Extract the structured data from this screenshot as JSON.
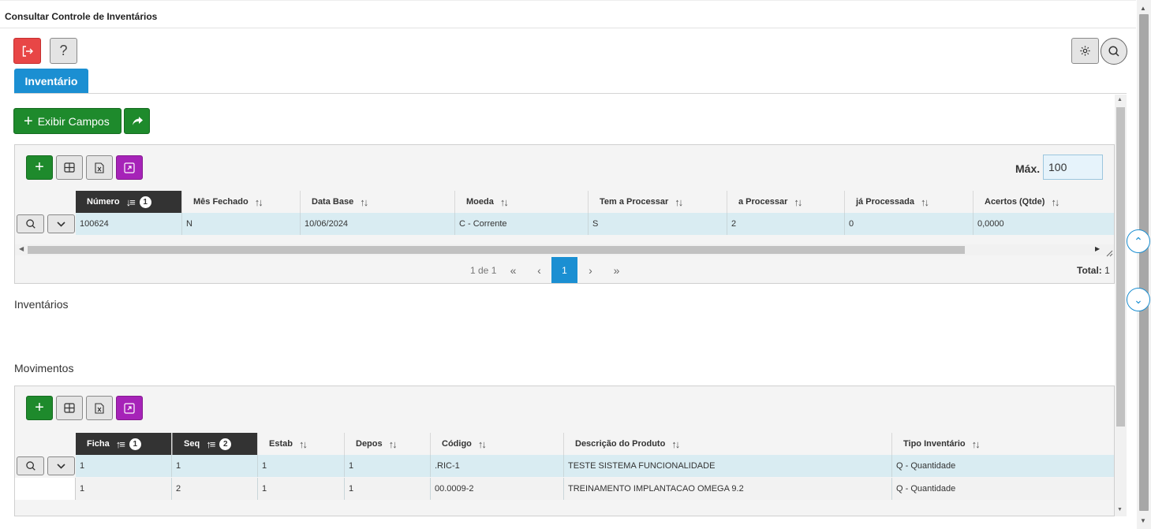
{
  "window": {
    "title": "Consultar Controle de Inventários"
  },
  "top_buttons": {
    "exit_icon": "exit-icon",
    "help_label": "?",
    "settings_icon": "gear-icon",
    "search_icon": "search-icon"
  },
  "tabs": [
    {
      "label": "Inventário",
      "active": true
    }
  ],
  "actions": {
    "exibir_campos": "Exibir Campos",
    "share_icon": "share-icon"
  },
  "inventory_grid": {
    "max_label": "Máx.",
    "max_value": "100",
    "columns": [
      {
        "label": "Número",
        "sort_order": "1"
      },
      {
        "label": "Mês Fechado"
      },
      {
        "label": "Data Base"
      },
      {
        "label": "Moeda"
      },
      {
        "label": "Tem a Processar"
      },
      {
        "label": "a Processar"
      },
      {
        "label": "já Processada"
      },
      {
        "label": "Acertos (Qtde)"
      }
    ],
    "rows": [
      [
        "100624",
        "N",
        "10/06/2024",
        "C - Corrente",
        "S",
        "2",
        "0",
        "0,0000"
      ]
    ],
    "pager": {
      "info": "1 de 1",
      "current_page": "1",
      "total_label": "Total:",
      "total_value": "1"
    }
  },
  "section_inventarios": "Inventários",
  "section_movimentos": "Movimentos",
  "movements_grid": {
    "columns": [
      {
        "label": "Ficha",
        "sort_order": "1"
      },
      {
        "label": "Seq",
        "sort_order": "2"
      },
      {
        "label": "Estab"
      },
      {
        "label": "Depos"
      },
      {
        "label": "Código"
      },
      {
        "label": "Descrição do Produto"
      },
      {
        "label": "Tipo Inventário"
      }
    ],
    "rows": [
      [
        "1",
        "1",
        "1",
        "1",
        ".RIC-1",
        "TESTE SISTEMA FUNCIONALIDADE",
        "Q  - Quantidade"
      ],
      [
        "1",
        "2",
        "1",
        "1",
        "00.0009-2",
        "TREINAMENTO IMPLANTACAO OMEGA 9.2",
        "Q  - Quantidade"
      ]
    ]
  },
  "colors": {
    "accent": "#1b8fd2",
    "green": "#1e8a2c",
    "red": "#e84646",
    "purple": "#a623b8",
    "header_dark": "#333333",
    "selected_row": "#d9ecf2"
  }
}
